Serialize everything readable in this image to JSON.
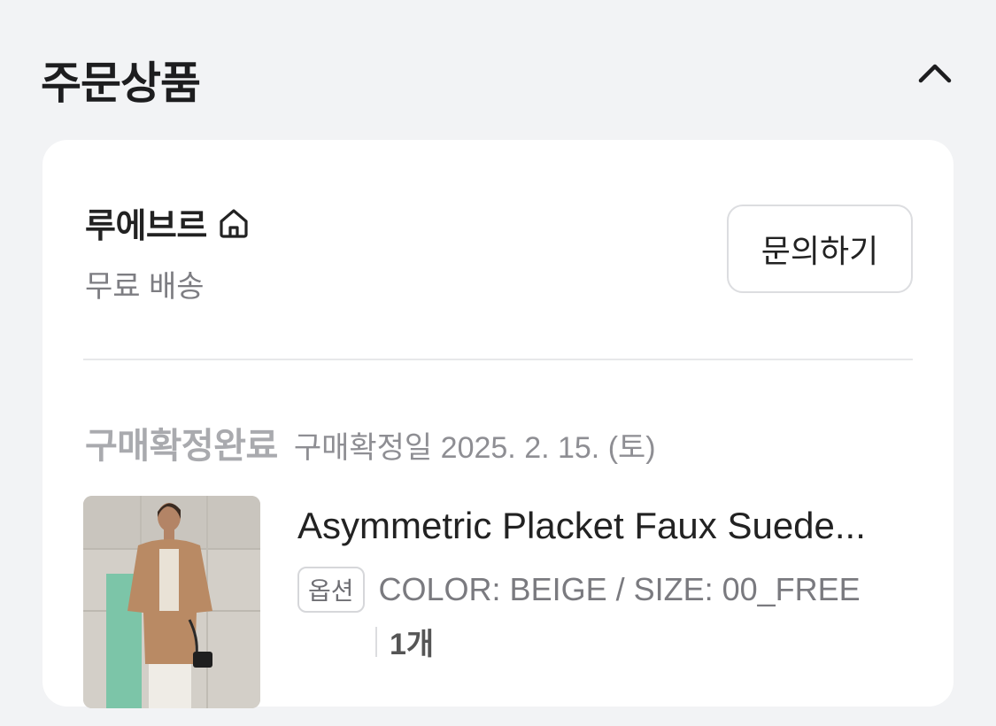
{
  "section": {
    "title": "주문상품"
  },
  "seller": {
    "name": "루에브르",
    "shipping": "무료 배송",
    "inquiry_label": "문의하기"
  },
  "order": {
    "status": "구매확정완료",
    "confirm_date": "구매확정일 2025. 2. 15. (토)"
  },
  "product": {
    "name": "Asymmetric Placket Faux Suede...",
    "option_tag": "옵션",
    "option_value": "COLOR: BEIGE / SIZE: 00_FREE",
    "quantity": "1개"
  },
  "icons": {
    "collapse": "chevron-up-icon",
    "store": "home-icon"
  },
  "colors": {
    "background": "#f2f3f5",
    "card": "#ffffff",
    "status_text": "#a9aaae"
  }
}
